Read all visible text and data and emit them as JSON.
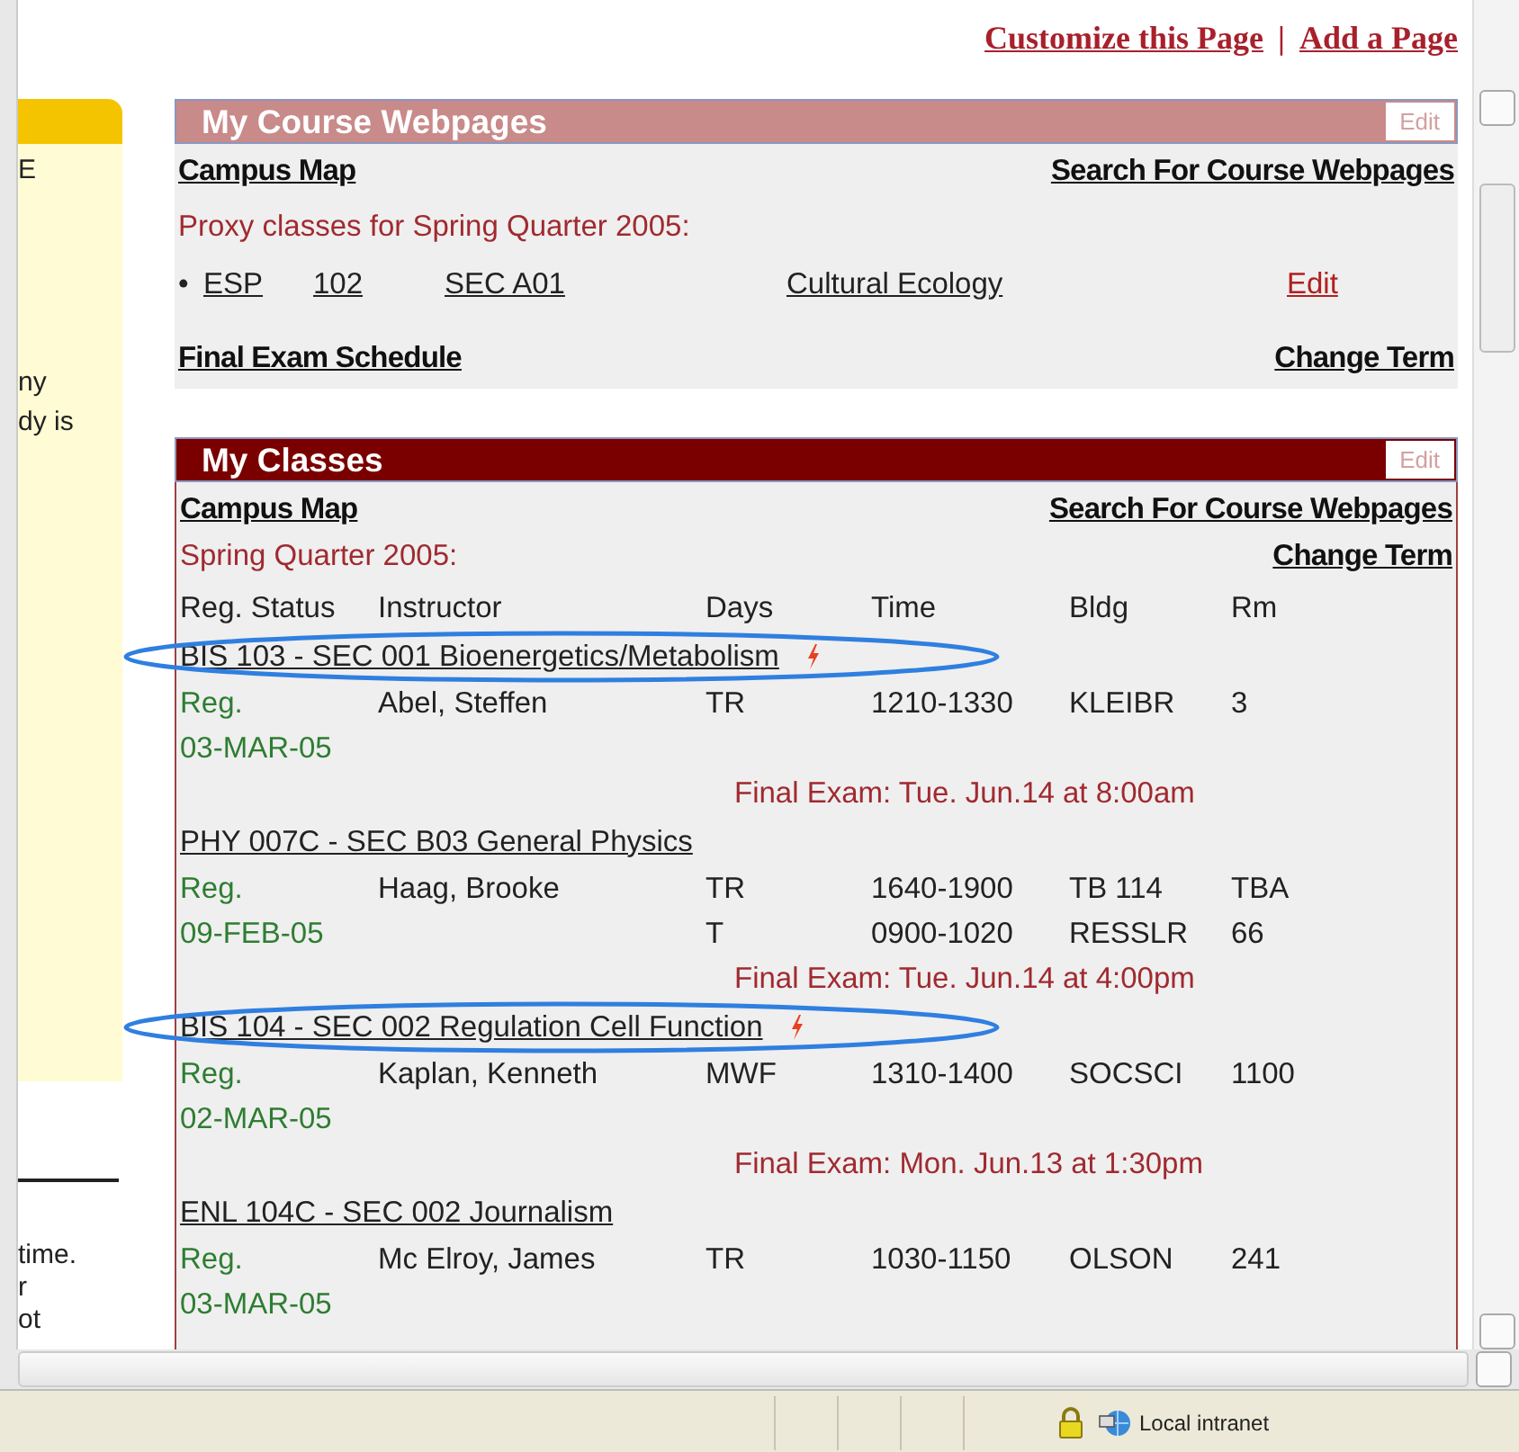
{
  "top_links": [
    "Customize this Page",
    "|",
    "Add a Page"
  ],
  "left_panel": {
    "top_texts": [
      "E",
      "ny",
      "dy is"
    ],
    "bottom_texts": [
      "time.",
      "r",
      "ot"
    ]
  },
  "course_webpages": {
    "title": "My Course Webpages",
    "edit": "Edit",
    "links": [
      "Campus Map",
      "Search For Course Webpages"
    ],
    "proxy_heading": "Proxy classes for Spring Quarter 2005:",
    "proxy_classes": [
      {
        "bullet": "•",
        "subject": "ESP",
        "number": "102",
        "section": "SEC A01",
        "title": "Cultural Ecology",
        "edit": "Edit"
      }
    ],
    "footer_links": [
      "Final Exam Schedule",
      "Change Term"
    ]
  },
  "my_classes": {
    "title": "My Classes",
    "edit": "Edit",
    "links": [
      "Campus Map",
      "Search For Course Webpages"
    ],
    "term": "Spring Quarter 2005:",
    "change_term": "Change Term",
    "columns": [
      "Reg. Status",
      "Instructor",
      "Days",
      "Time",
      "Bldg",
      "Rm"
    ],
    "classes": [
      {
        "title": "BIS 103 - SEC 001 Bioenergetics/Metabolism",
        "alert": true,
        "circled": true,
        "status": "Reg.",
        "date": "03-MAR-05",
        "instructor": "Abel, Steffen",
        "meetings": [
          {
            "days": "TR",
            "time": "1210-1330",
            "bldg": "KLEIBR",
            "rm": "3"
          }
        ],
        "final_exam": "Final Exam: Tue. Jun.14 at 8:00am"
      },
      {
        "title": "PHY 007C - SEC B03 General Physics",
        "alert": false,
        "circled": false,
        "status": "Reg.",
        "date": "09-FEB-05",
        "instructor": "Haag, Brooke",
        "meetings": [
          {
            "days": "TR",
            "time": "1640-1900",
            "bldg": "TB 114",
            "rm": "TBA"
          },
          {
            "days": "T",
            "time": "0900-1020",
            "bldg": "RESSLR",
            "rm": "66"
          }
        ],
        "final_exam": "Final Exam: Tue. Jun.14 at 4:00pm"
      },
      {
        "title": "BIS 104 - SEC 002 Regulation Cell Function",
        "alert": true,
        "circled": true,
        "status": "Reg.",
        "date": "02-MAR-05",
        "instructor": "Kaplan, Kenneth",
        "meetings": [
          {
            "days": "MWF",
            "time": "1310-1400",
            "bldg": "SOCSCI",
            "rm": "1100"
          }
        ],
        "final_exam": "Final Exam: Mon. Jun.13 at 1:30pm"
      },
      {
        "title": "ENL 104C - SEC 002 Journalism",
        "alert": false,
        "circled": false,
        "status": "Reg.",
        "date": "03-MAR-05",
        "instructor": "Mc Elroy, James",
        "meetings": [
          {
            "days": "TR",
            "time": "1030-1150",
            "bldg": "OLSON",
            "rm": "241"
          }
        ]
      }
    ]
  },
  "status_bar": {
    "zone": "Local intranet"
  }
}
